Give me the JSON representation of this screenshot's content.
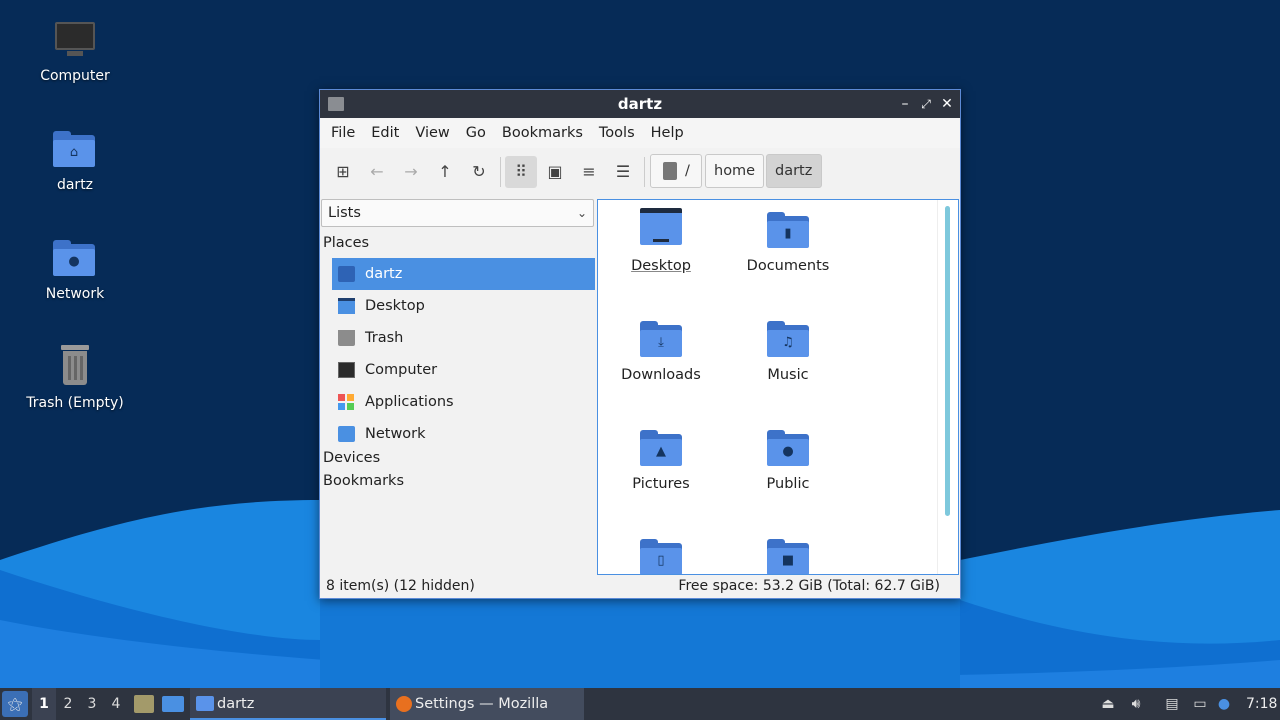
{
  "desktop": {
    "icons": [
      {
        "label": "Computer",
        "icon": "monitor-icon"
      },
      {
        "label": "dartz",
        "icon": "home-folder-icon"
      },
      {
        "label": "Network",
        "icon": "network-folder-icon"
      },
      {
        "label": "Trash (Empty)",
        "icon": "trash-icon"
      }
    ]
  },
  "window": {
    "title": "dartz",
    "controls": {
      "minimize": "–",
      "maximize": "⤢",
      "close": "✕"
    },
    "menu": [
      "File",
      "Edit",
      "View",
      "Go",
      "Bookmarks",
      "Tools",
      "Help"
    ],
    "toolbar": {
      "new_tab": "⊞",
      "back": "←",
      "forward": "→",
      "up": "↑",
      "reload": "↻",
      "icon_view": "⠿",
      "thumb_view": "▣",
      "compact_view": "≡",
      "detail_view": "☰"
    },
    "breadcrumb": {
      "root": "/",
      "home": "home",
      "current": "dartz"
    },
    "sidebar": {
      "mode": "Lists",
      "sections": {
        "places": "Places",
        "devices": "Devices",
        "bookmarks": "Bookmarks"
      },
      "places": [
        {
          "label": "dartz",
          "icon": "home-folder-icon",
          "selected": true
        },
        {
          "label": "Desktop",
          "icon": "desktop-icon"
        },
        {
          "label": "Trash",
          "icon": "trash-icon"
        },
        {
          "label": "Computer",
          "icon": "monitor-icon"
        },
        {
          "label": "Applications",
          "icon": "applications-icon"
        },
        {
          "label": "Network",
          "icon": "network-folder-icon"
        }
      ]
    },
    "items": [
      {
        "label": "Desktop",
        "icon": "desktop-folder-icon"
      },
      {
        "label": "Documents",
        "icon": "documents-folder-icon"
      },
      {
        "label": "Downloads",
        "icon": "downloads-folder-icon"
      },
      {
        "label": "Music",
        "icon": "music-folder-icon"
      },
      {
        "label": "Pictures",
        "icon": "pictures-folder-icon"
      },
      {
        "label": "Public",
        "icon": "public-folder-icon"
      },
      {
        "label": "",
        "icon": "templates-folder-icon"
      },
      {
        "label": "",
        "icon": "videos-folder-icon"
      }
    ],
    "status": {
      "items": "8 item(s) (12 hidden)",
      "space": "Free space: 53.2 GiB (Total: 62.7 GiB)"
    }
  },
  "taskbar": {
    "workspaces": [
      "1",
      "2",
      "3",
      "4"
    ],
    "tasks": [
      {
        "label": "dartz",
        "active": true
      },
      {
        "label": "Settings — Mozilla Fir…",
        "active": false
      }
    ],
    "clock": "7:18"
  },
  "colors": {
    "accent": "#4a90e2",
    "folder": "#5a93ea",
    "titlebar": "#2f343f",
    "taskbar": "#2e3440"
  }
}
